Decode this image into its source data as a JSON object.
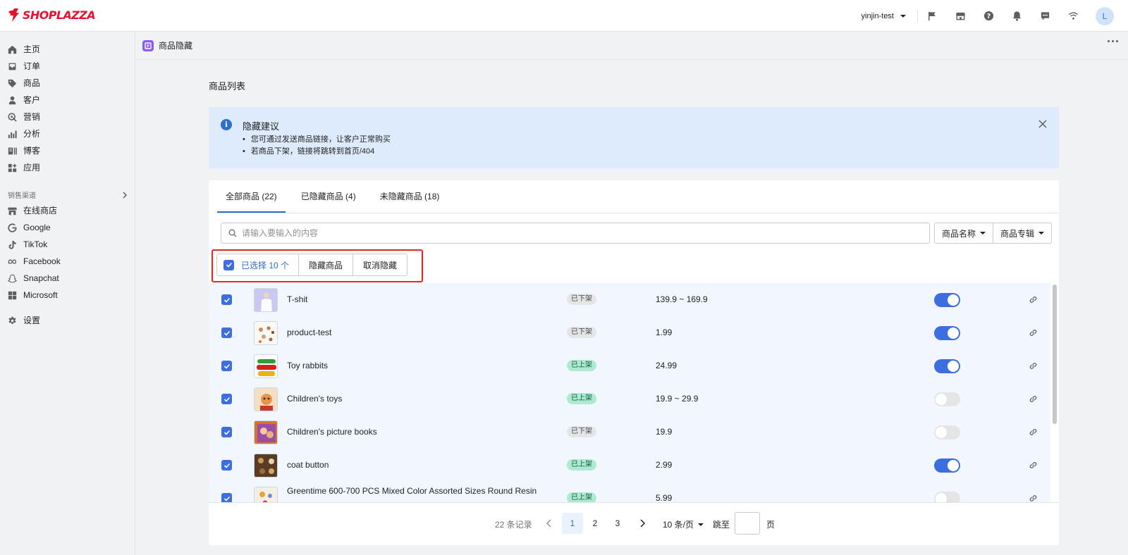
{
  "brand": {
    "logo_text": "SHOPLAZZA",
    "logo_color": "#e8112d"
  },
  "topbar": {
    "store_name": "yinjin-test",
    "avatar_initial": "L",
    "icons": [
      "flag-icon",
      "store-icon",
      "help-icon",
      "bell-icon",
      "chat-icon",
      "wifi-icon"
    ]
  },
  "sidebar": {
    "items": [
      {
        "label": "主页",
        "icon": "home-icon"
      },
      {
        "label": "订单",
        "icon": "orders-icon"
      },
      {
        "label": "商品",
        "icon": "tag-icon"
      },
      {
        "label": "客户",
        "icon": "person-icon"
      },
      {
        "label": "营销",
        "icon": "marketing-icon"
      },
      {
        "label": "分析",
        "icon": "chart-icon"
      },
      {
        "label": "博客",
        "icon": "blog-icon"
      },
      {
        "label": "应用",
        "icon": "apps-icon"
      }
    ],
    "channels_label": "销售渠道",
    "channels": [
      {
        "label": "在线商店",
        "icon": "store-icon"
      },
      {
        "label": "Google",
        "icon": "google-icon"
      },
      {
        "label": "TikTok",
        "icon": "tiktok-icon"
      },
      {
        "label": "Facebook",
        "icon": "meta-icon"
      },
      {
        "label": "Snapchat",
        "icon": "snapchat-icon"
      },
      {
        "label": "Microsoft",
        "icon": "microsoft-icon"
      }
    ],
    "settings_label": "设置"
  },
  "page": {
    "app_title": "商品隐藏",
    "title": "商品列表"
  },
  "banner": {
    "title": "隐藏建议",
    "lines": [
      "您可通过发送商品链接，让客户正常购买",
      "若商品下架，链接将跳转到首页/404"
    ]
  },
  "tabs": [
    {
      "label": "全部商品 (22)",
      "active": true
    },
    {
      "label": "已隐藏商品 (4)",
      "active": false
    },
    {
      "label": "未隐藏商品 (18)",
      "active": false
    }
  ],
  "search": {
    "placeholder": "请输入要输入的内容",
    "value": ""
  },
  "filters": {
    "name_label": "商品名称",
    "collection_label": "商品专辑"
  },
  "bulk": {
    "selected_label": "已选择 10 个",
    "hide_label": "隐藏商品",
    "unhide_label": "取消隐藏"
  },
  "products": [
    {
      "name": "T-shit",
      "status": "已下架",
      "listed": false,
      "price": "139.9 ~ 169.9",
      "hidden": true
    },
    {
      "name": "product-test",
      "status": "已下架",
      "listed": false,
      "price": "1.99",
      "hidden": true
    },
    {
      "name": "Toy rabbits",
      "status": "已上架",
      "listed": true,
      "price": "24.99",
      "hidden": true
    },
    {
      "name": "Children's toys",
      "status": "已上架",
      "listed": true,
      "price": "19.9 ~ 29.9",
      "hidden": false
    },
    {
      "name": "Children's picture books",
      "status": "已下架",
      "listed": false,
      "price": "19.9",
      "hidden": false
    },
    {
      "name": "coat button",
      "status": "已上架",
      "listed": true,
      "price": "2.99",
      "hidden": true
    },
    {
      "name": "Greentime 600-700 PCS Mixed Color Assorted Sizes Round Resin",
      "status": "已上架",
      "listed": true,
      "price": "5.99",
      "hidden": false
    }
  ],
  "pagination": {
    "total_label": "22 条记录",
    "pages": [
      "1",
      "2",
      "3"
    ],
    "current": "1",
    "page_size": "10 条/页",
    "jump_label": "跳至",
    "page_suffix": "页"
  }
}
